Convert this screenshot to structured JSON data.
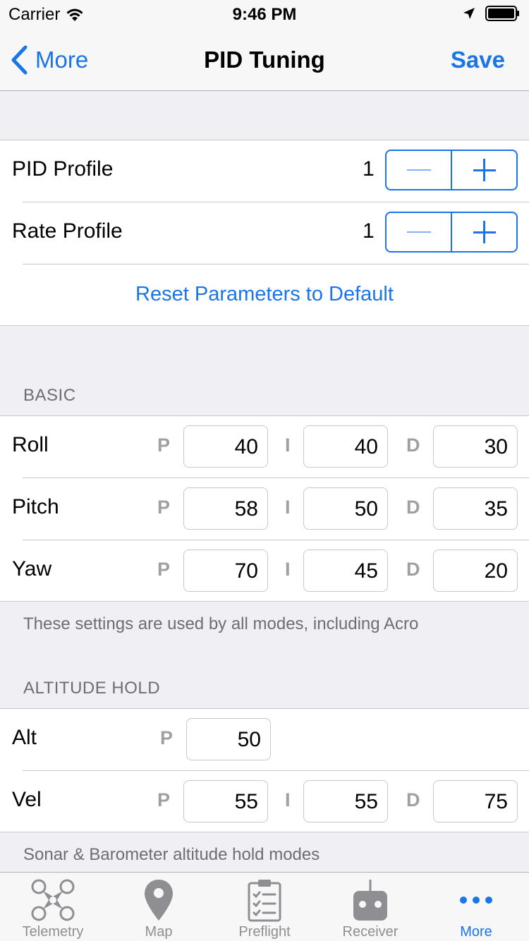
{
  "status_bar": {
    "carrier": "Carrier",
    "time": "9:46 PM"
  },
  "nav": {
    "back_label": "More",
    "title": "PID Tuning",
    "save_label": "Save"
  },
  "profiles": {
    "pid_profile": {
      "label": "PID Profile",
      "value": "1"
    },
    "rate_profile": {
      "label": "Rate Profile",
      "value": "1"
    },
    "reset_label": "Reset Parameters to Default"
  },
  "basic": {
    "header": "BASIC",
    "letters": {
      "p": "P",
      "i": "I",
      "d": "D"
    },
    "rows": [
      {
        "label": "Roll",
        "p": "40",
        "i": "40",
        "d": "30"
      },
      {
        "label": "Pitch",
        "p": "58",
        "i": "50",
        "d": "35"
      },
      {
        "label": "Yaw",
        "p": "70",
        "i": "45",
        "d": "20"
      }
    ],
    "footer": "These settings are used by all modes, including Acro"
  },
  "altitude_hold": {
    "header": "ALTITUDE HOLD",
    "alt": {
      "label": "Alt",
      "p": "50"
    },
    "vel": {
      "label": "Vel",
      "p": "55",
      "i": "55",
      "d": "75"
    },
    "footer": "Sonar & Barometer altitude hold modes"
  },
  "tabs": [
    {
      "label": "Telemetry",
      "icon": "quadcopter-icon"
    },
    {
      "label": "Map",
      "icon": "map-pin-icon"
    },
    {
      "label": "Preflight",
      "icon": "checklist-icon"
    },
    {
      "label": "Receiver",
      "icon": "remote-control-icon"
    },
    {
      "label": "More",
      "icon": "more-dots-icon",
      "active": true
    }
  ],
  "colors": {
    "accent": "#1a75e8",
    "background": "#efeff4",
    "inactive_tab": "#8e8e93"
  }
}
